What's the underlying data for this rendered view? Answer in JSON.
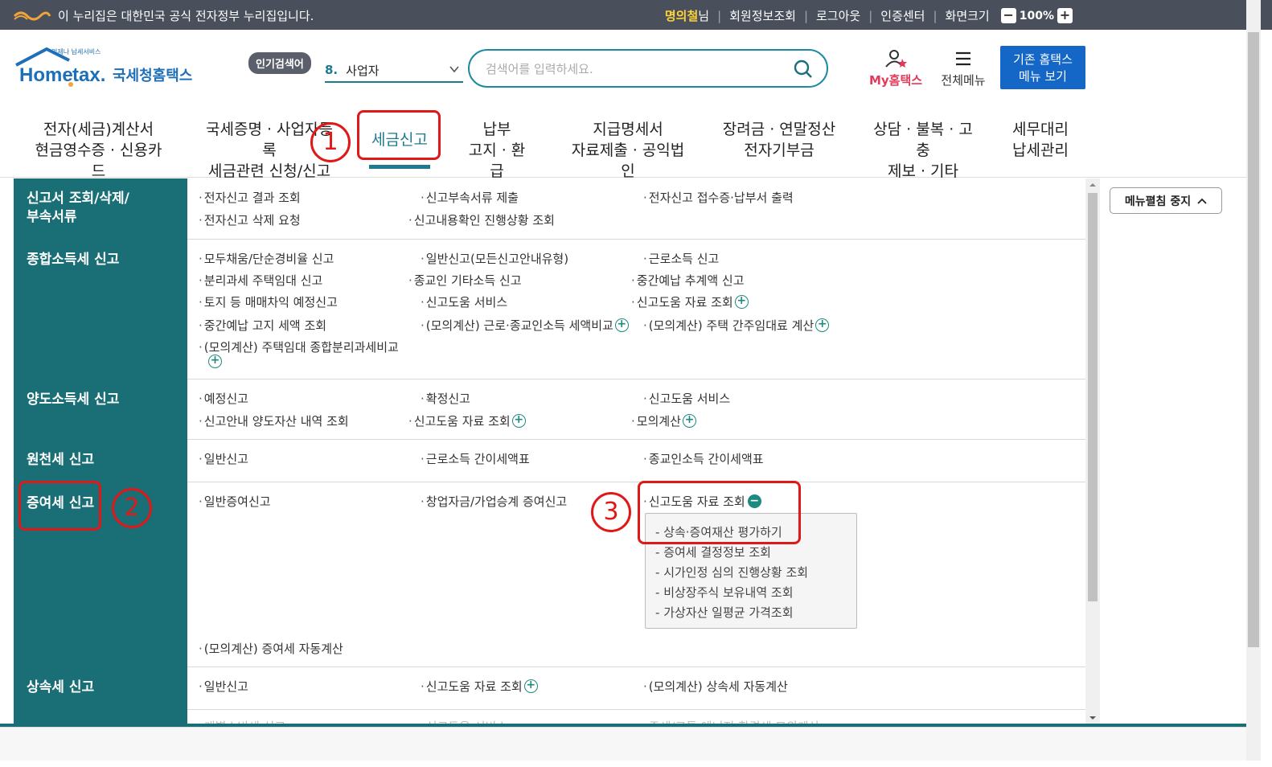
{
  "topbar": {
    "gov_notice": "이 누리집은 대한민국 공식 전자정부 누리집입니다.",
    "user_name": "명의철",
    "user_suffix": "님",
    "links": [
      "회원정보조회",
      "로그아웃",
      "인증센터",
      "화면크기"
    ],
    "zoom": "100%",
    "zoom_minus": "−",
    "zoom_plus": "+"
  },
  "header": {
    "logo_text": "Hometax.",
    "logo_kor": "국세청홈택스",
    "logo_tagline": "언제나 납세서비스",
    "popular_label": "인기검색어",
    "popular_rank": "8.",
    "popular_term": "사업자",
    "search_placeholder": "검색어를 입력하세요.",
    "my_hometax": "My홈택스",
    "all_menu": "전체메뉴",
    "old_menu_line1": "기존 홈택스",
    "old_menu_line2": "메뉴 보기"
  },
  "gnb": [
    {
      "l1": "전자(세금)계산서",
      "l2": "현금영수증 · 신용카드"
    },
    {
      "l1": "국세증명 · 사업자등록",
      "l2": "세금관련 신청/신고"
    },
    {
      "l1": "세금신고",
      "l2": ""
    },
    {
      "l1": "납부",
      "l2": "고지 · 환급"
    },
    {
      "l1": "지급명세서",
      "l2": "자료제출 · 공익법인"
    },
    {
      "l1": "장려금 · 연말정산",
      "l2": "전자기부금"
    },
    {
      "l1": "상담 · 불복 · 고충",
      "l2": "제보 · 기타"
    },
    {
      "l1": "세무대리",
      "l2": "납세관리"
    }
  ],
  "annotations": [
    "1",
    "2",
    "3"
  ],
  "categories": [
    "신고서 조회/삭제/",
    "부속서류",
    "종합소득세 신고",
    "양도소득세 신고",
    "원천세 신고",
    "증여세 신고",
    "상속세 신고"
  ],
  "menu": {
    "doc": [
      "전자신고 결과 조회",
      "신고부속서류 제출",
      "전자신고 접수증·납부서 출력",
      "전자신고 삭제 요청",
      "신고내용확인 진행상황 조회"
    ],
    "income": [
      "모두채움/단순경비율 신고",
      "일반신고(모든신고안내유형)",
      "근로소득 신고",
      "분리과세 주택임대 신고",
      "종교인 기타소득 신고",
      "중간예납 추계액 신고",
      "토지 등 매매차익 예정신고",
      "신고도움 서비스",
      "신고도움 자료 조회",
      "중간예납 고지 세액 조회",
      "(모의계산) 근로·종교인소득 세액비교",
      "(모의계산) 주택 간주임대료 계산",
      "(모의계산) 주택임대 종합분리과세비교"
    ],
    "transfer": [
      "예정신고",
      "확정신고",
      "신고도움 서비스",
      "신고안내 양도자산 내역 조회",
      "신고도움 자료 조회",
      "모의계산"
    ],
    "withholding": [
      "일반신고",
      "근로소득 간이세액표",
      "종교인소득 간이세액표"
    ],
    "gift": [
      "일반증여신고",
      "창업자금/가업승계 증여신고",
      "신고도움 자료 조회",
      "(모의계산) 증여세 자동계산"
    ],
    "gift_sub": [
      "상속·증여재산 평가하기",
      "증여세 결정정보 조회",
      "시가인정 심의 진행상황 조회",
      "비상장주식 보유내역 조회",
      "가상자산 일평균 가격조회"
    ],
    "inherit": [
      "일반신고",
      "신고도움 자료 조회",
      "(모의계산) 상속세 자동계산"
    ],
    "cut": [
      "개별소비세 신고",
      "신고도움 서비스",
      "주세/교통 에너지 환경세 모의계산"
    ]
  },
  "side": {
    "stop_label": "메뉴펼침 중지"
  }
}
